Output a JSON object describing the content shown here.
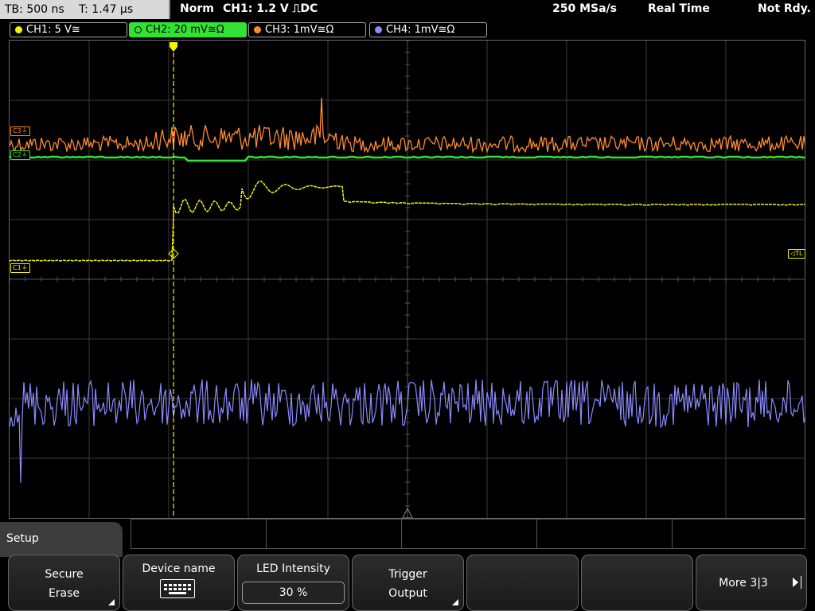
{
  "status": {
    "timebase": "TB: 500 ns",
    "trigger_time": "T: 1.47 µs",
    "acq_mode": "Norm",
    "trigger_info": "CH1: 1.2 V ⎍DC",
    "sample_rate": "250 MSa/s",
    "run_mode": "Real Time",
    "state": "Not Rdy."
  },
  "channels": [
    {
      "label": "CH1: 5 V≅",
      "color": "#f5f500",
      "active": false
    },
    {
      "label": "CH2: 20 mV≅Ω",
      "color": "#33e233",
      "active": true
    },
    {
      "label": "CH3: 1mV≅Ω",
      "color": "#ff8a30",
      "active": false
    },
    {
      "label": "CH4: 1mV≅Ω",
      "color": "#8a8aff",
      "active": false
    }
  ],
  "markers": {
    "c3": "C3",
    "c2": "C2",
    "c1": "C1",
    "tl": "TL"
  },
  "menu": {
    "title": "Setup",
    "softkeys": [
      {
        "line1": "Secure",
        "line2": "Erase"
      },
      {
        "title": "Device name"
      },
      {
        "title": "LED Intensity",
        "value": "30 %"
      },
      {
        "line1": "Trigger",
        "line2": "Output"
      },
      {
        "line1": ""
      },
      {
        "line1": ""
      },
      {
        "label": "More 3|3"
      }
    ]
  }
}
